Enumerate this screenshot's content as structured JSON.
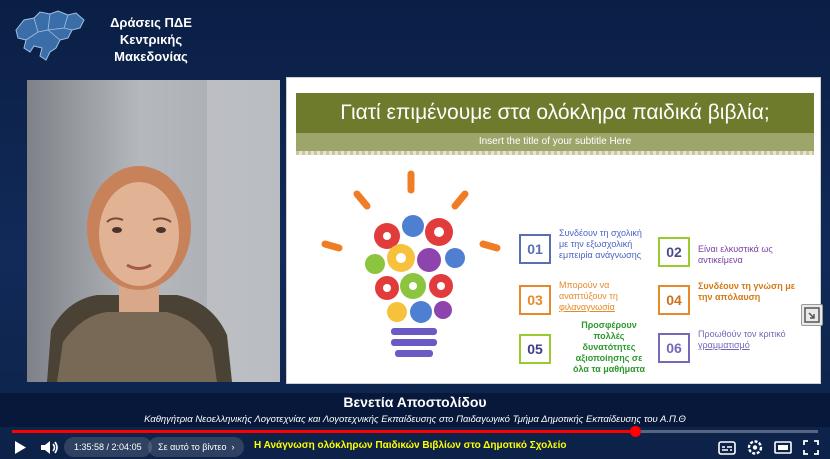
{
  "brand": {
    "line1": "Δράσεις ΠΔΕ",
    "line2": "Κεντρικής",
    "line3": "Μακεδονίας",
    "icon": "macedonia-map-logo"
  },
  "slide": {
    "title": "Γιατί επιμένουμε στα ολόκληρα παιδικά βιβλία;",
    "subtitle": "Insert the title of your subtitle Here",
    "items": [
      {
        "num": "01",
        "line1": "Συνδέουν τη σχολική",
        "line2": "με την εξωσχολική",
        "line3": "εμπειρία ανάγνωσης",
        "color": "#5a6fb0"
      },
      {
        "num": "02",
        "line1": "Είναι ελκυστικά ως",
        "line2": "αντικείμενα",
        "color": "#9acb2c"
      },
      {
        "num": "03",
        "line1": "Μπορούν να",
        "line2": "αναπτύξουν τη",
        "line3": "φιλαναγνωσία",
        "color": "#e58a2b"
      },
      {
        "num": "04",
        "line1": "Συνδέουν τη γνώση με",
        "line2": "την απόλαυση",
        "color": "#e58a2b"
      },
      {
        "num": "05",
        "line1": "Προσφέρουν",
        "line2": "πολλές",
        "line3": "δυνατότητες",
        "line4": "αξιοποίησης σε",
        "line5": "όλα τα μαθήματα",
        "color": "#3ea83a"
      },
      {
        "num": "06",
        "line1": "Προωθούν τον κριτικό",
        "line2": "γραμματισμό",
        "color": "#7667b8"
      }
    ]
  },
  "speaker": {
    "name": "Βενετία Αποστολίδου",
    "role": "Καθηγήτρια Νεοελληνικής Λογοτεχνίας και Λογοτεχνικής Εκπαίδευσης στο Παιδαγωγικό Τμήμα Δημοτικής Εκπαίδευσης του Α.Π.Θ"
  },
  "player": {
    "current_time": "1:35:58",
    "separator": " / ",
    "duration": "2:04:05",
    "progress": 0.773,
    "chapter_label": "Σε αυτό το βίντεο",
    "video_title": "Η Ανάγνωση ολόκληρων Παιδικών Βιβλίων στο Δημοτικό Σχολείο",
    "accent_color": "#ff0000"
  }
}
